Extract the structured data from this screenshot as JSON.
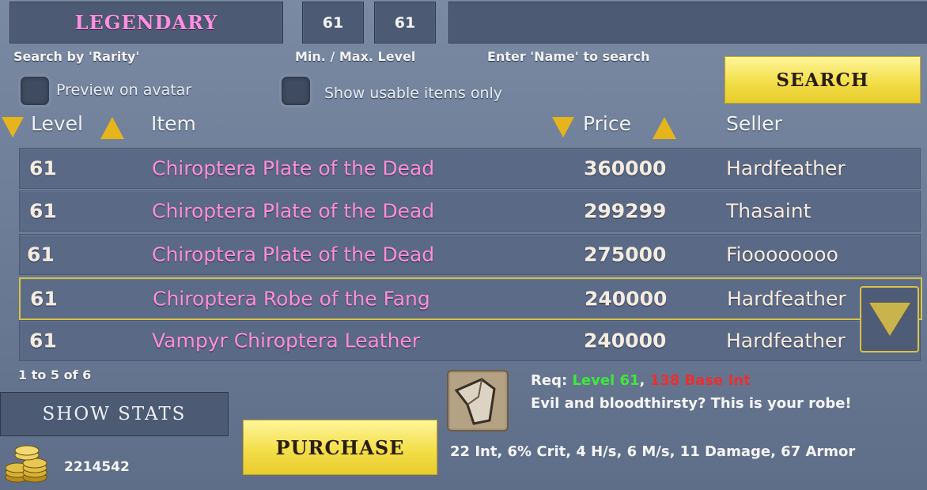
{
  "filters": {
    "rarity": "LEGENDARY",
    "min_level": "61",
    "max_level": "61",
    "name_value": "",
    "rarity_label": "Search by 'Rarity'",
    "level_label": "Min. / Max. Level",
    "name_label": "Enter 'Name' to search",
    "preview_label": "Preview on avatar",
    "usable_label": "Show usable items only",
    "search_button": "SEARCH"
  },
  "table": {
    "headers": {
      "level": "Level",
      "item": "Item",
      "price": "Price",
      "seller": "Seller"
    },
    "rows": [
      {
        "level": "61",
        "item": "Chiroptera Plate of the Dead",
        "price": "360000",
        "seller": "Hardfeather"
      },
      {
        "level": "61",
        "item": "Chiroptera Plate of the Dead",
        "price": "299299",
        "seller": "Thasaint"
      },
      {
        "level": "61",
        "item": "Chiroptera Plate of the Dead",
        "price": "275000",
        "seller": "Fioooooooo"
      },
      {
        "level": "61",
        "item": "Chiroptera Robe of the Fang",
        "price": "240000",
        "seller": "Hardfeather"
      },
      {
        "level": "61",
        "item": "Vampyr Chiroptera Leather",
        "price": "240000",
        "seller": "Hardfeather"
      }
    ],
    "selected_index": 3,
    "paging": "1 to 5 of 6"
  },
  "footer": {
    "show_stats": "SHOW STATS",
    "gold": "2214542",
    "purchase": "PURCHASE"
  },
  "details": {
    "req_prefix": "Req:",
    "req_level": "Level 61",
    "req_sep": ",",
    "req_int": "138 Base Int",
    "description": "Evil and bloodthirsty? This is your robe!",
    "stats": "22 Int, 6% Crit, 4 H/s, 6 M/s, 11 Damage, 67 Armor"
  },
  "colors": {
    "legendary": "#ff8fe0",
    "item_name": "#ff8fd6",
    "req_met": "#3ee83b",
    "req_unmet": "#e83030",
    "accent_yellow": "#e6b41b"
  },
  "icons": [
    "sort-desc-icon",
    "sort-asc-icon",
    "scroll-down-icon",
    "gold-coins-icon",
    "robe-item-icon",
    "checkbox-icon"
  ]
}
